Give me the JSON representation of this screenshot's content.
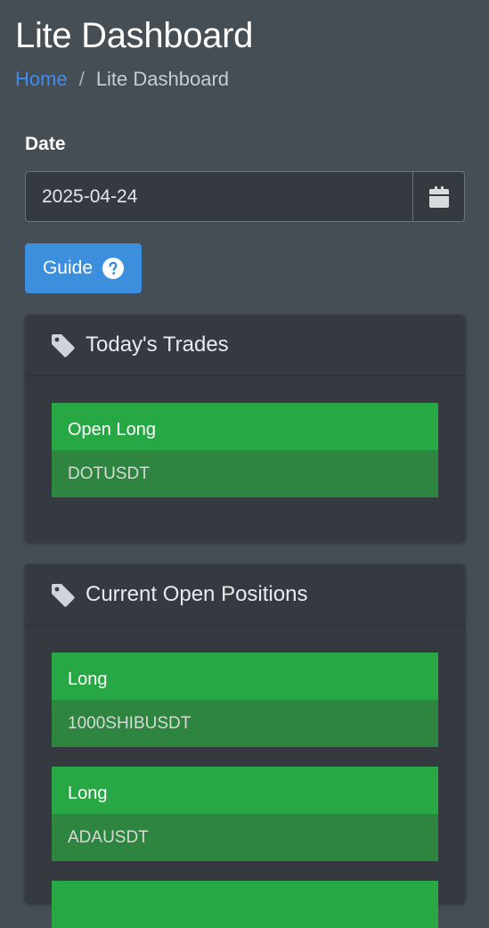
{
  "header": {
    "title": "Lite Dashboard",
    "breadcrumb": {
      "home": "Home",
      "separator": "/",
      "current": "Lite Dashboard"
    }
  },
  "date": {
    "label": "Date",
    "value": "2025-04-24",
    "icon": "calendar-icon"
  },
  "guide": {
    "label": "Guide",
    "icon": "question-circle-icon"
  },
  "todays_trades": {
    "title": "Today's Trades",
    "icon": "tag-icon",
    "items": [
      {
        "action": "Open Long",
        "symbol": "DOTUSDT"
      }
    ]
  },
  "open_positions": {
    "title": "Current Open Positions",
    "icon": "tag-icon",
    "items": [
      {
        "side": "Long",
        "symbol": "1000SHIBUSDT"
      },
      {
        "side": "Long",
        "symbol": "ADAUSDT"
      }
    ]
  },
  "colors": {
    "background": "#454d55",
    "card": "#343a40",
    "accent": "#3c8fdc",
    "success": "#28a745",
    "success_dark": "#2e8540",
    "link": "#3f8cf0"
  }
}
